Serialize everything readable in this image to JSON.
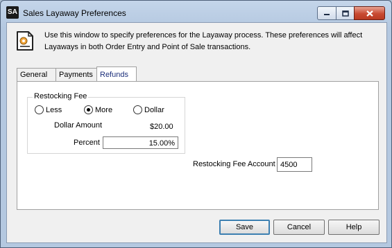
{
  "window": {
    "app_icon_text": "SA",
    "title": "Sales Layaway Preferences"
  },
  "info": {
    "icon": "document-settings-icon",
    "text": "Use this window to specify preferences for the Layaway process. These preferences will affect Layaways in both Order Entry and Point of Sale transactions."
  },
  "tabs": [
    {
      "label": "General",
      "active": false
    },
    {
      "label": "Payments",
      "active": false
    },
    {
      "label": "Refunds",
      "active": true
    }
  ],
  "restocking": {
    "group_label": "Restocking Fee",
    "options": [
      {
        "label": "Less",
        "selected": false
      },
      {
        "label": "More",
        "selected": true
      },
      {
        "label": "Dollar",
        "selected": false
      }
    ],
    "dollar_amount_label": "Dollar Amount",
    "dollar_amount_value": "$20.00",
    "percent_label": "Percent",
    "percent_value": "15.00%",
    "account_label": "Restocking Fee Account",
    "account_value": "4500"
  },
  "buttons": {
    "save": "Save",
    "cancel": "Cancel",
    "help": "Help"
  }
}
